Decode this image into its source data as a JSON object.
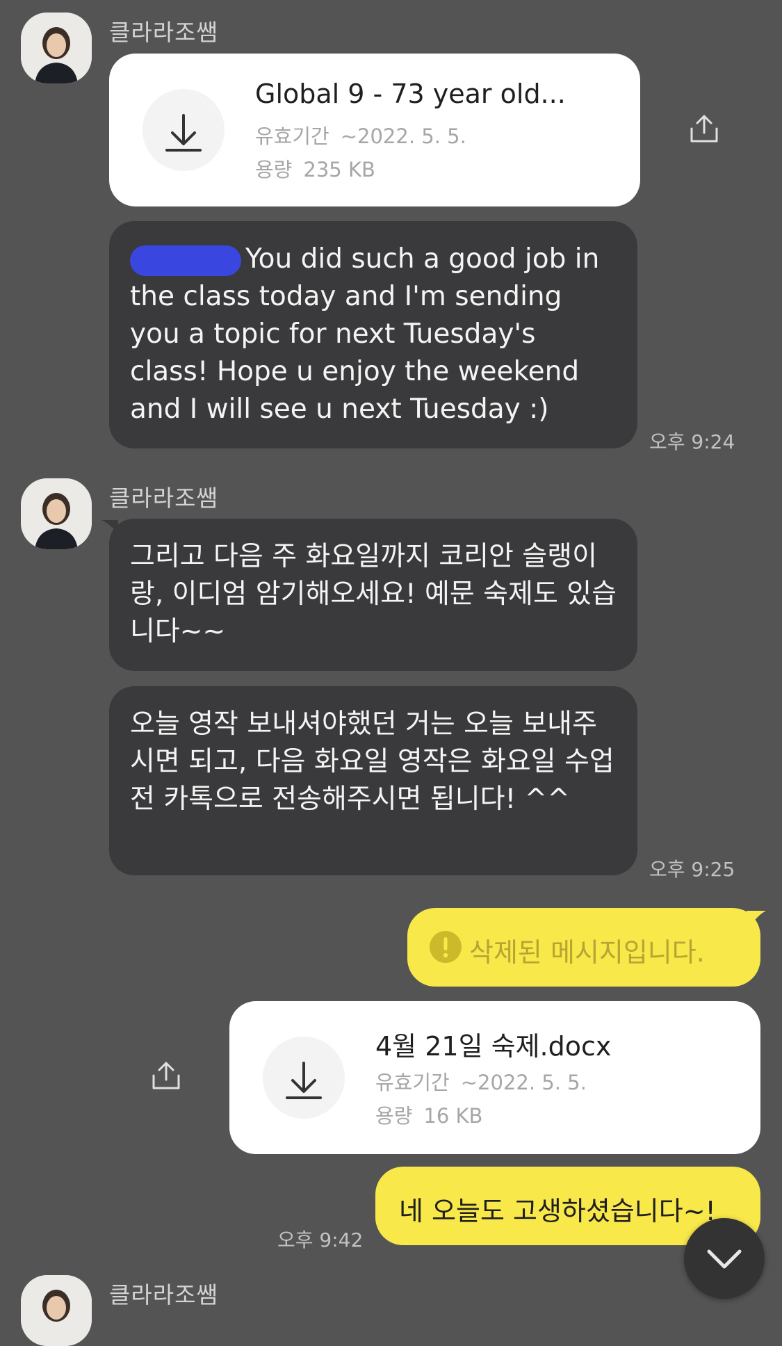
{
  "sender_name": "클라라조쌤",
  "messages": {
    "file1": {
      "name": "Global 9 - 73 year old...",
      "expiry_label": "유효기간",
      "expiry_value": "~2022. 5. 5.",
      "size_label": "용량",
      "size_value": "235 KB"
    },
    "text1": "You did such a good job in the class today and I'm sending you a topic for next Tuesday's class! Hope u enjoy the weekend and I will see u next Tuesday :)",
    "time1": "오후 9:24",
    "text2": "그리고 다음 주 화요일까지 코리안 슬랭이랑, 이디엄 암기해오세요! 예문 숙제도 있습니다~~",
    "text3": "오늘 영작 보내셔야했던 거는 오늘 보내주시면 되고, 다음 화요일 영작은 화요일 수업 전 카톡으로 전송해주시면 됩니다! ^^",
    "time2": "오후 9:25",
    "deleted": "삭제된 메시지입니다.",
    "file2": {
      "name": "4월 21일 숙제.docx",
      "expiry_label": "유효기간",
      "expiry_value": "~2022. 5. 5.",
      "size_label": "용량",
      "size_value": "16 KB"
    },
    "text4": "네 오늘도 고생하셨습니다~!",
    "time3": "오후 9:42"
  },
  "icons": {
    "download": "download-icon",
    "share": "share-icon",
    "alert": "alert-icon",
    "scroll_down": "chevron-down-icon"
  },
  "colors": {
    "background": "#545454",
    "dark_bubble": "#3a3a3c",
    "my_bubble": "#f8e84a",
    "file_card": "#ffffff"
  }
}
